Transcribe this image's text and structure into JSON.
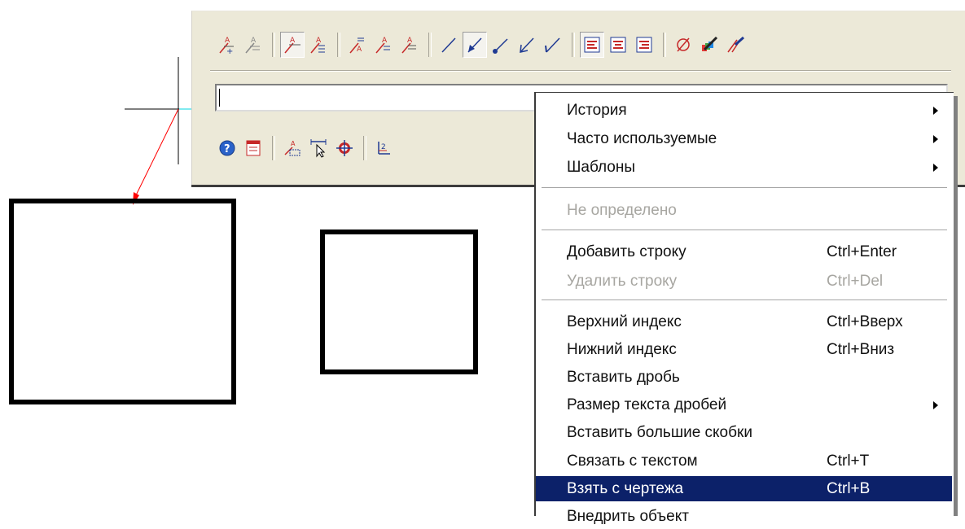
{
  "colors": {
    "panel_bg": "#ece9d8",
    "icon_red": "#c62828",
    "icon_blue": "#1f3a93",
    "selection": "#0c2169",
    "crosshair_cyan": "#00d4e0",
    "leader_red": "#ff0000"
  },
  "toolbar_top": {
    "icons": [
      "text-add-icon",
      "text-remove-icon",
      "text-leader-icon",
      "text-underline-icon",
      "text-multi-above-icon",
      "text-multi-below-icon",
      "text-three-lines-icon",
      "line-icon",
      "arrow-tail-icon",
      "dot-arrow-icon",
      "arrow-icon",
      "check-arrow-icon",
      "align-left-icon",
      "align-center-icon",
      "align-right-icon",
      "diameter-icon",
      "color-brush-icon",
      "leader-brush-icon"
    ]
  },
  "toolbar_bottom": {
    "icons": [
      "help-icon",
      "template-icon",
      "dimension-text-icon",
      "pick-dimension-icon",
      "target-icon",
      "power-index-icon"
    ]
  },
  "context_menu": {
    "items": [
      {
        "label": "История",
        "shortcut": "",
        "submenu": true,
        "disabled": false
      },
      {
        "label": "Часто используемые",
        "shortcut": "",
        "submenu": true,
        "disabled": false
      },
      {
        "label": "Шаблоны",
        "shortcut": "",
        "submenu": true,
        "disabled": false
      },
      {
        "label": "Не определено",
        "shortcut": "",
        "submenu": false,
        "disabled": true
      },
      {
        "label": "Добавить строку",
        "shortcut": "Ctrl+Enter",
        "submenu": false,
        "disabled": false
      },
      {
        "label": "Удалить строку",
        "shortcut": "Ctrl+Del",
        "submenu": false,
        "disabled": true
      },
      {
        "label": "Верхний индекс",
        "shortcut": "Ctrl+Вверх",
        "submenu": false,
        "disabled": false
      },
      {
        "label": "Нижний индекс",
        "shortcut": "Ctrl+Вниз",
        "submenu": false,
        "disabled": false
      },
      {
        "label": "Вставить дробь",
        "shortcut": "",
        "submenu": false,
        "disabled": false
      },
      {
        "label": "Размер текста дробей",
        "shortcut": "",
        "submenu": true,
        "disabled": false
      },
      {
        "label": "Вставить большие скобки",
        "shortcut": "",
        "submenu": false,
        "disabled": false
      },
      {
        "label": "Связать с текстом",
        "shortcut": "Ctrl+T",
        "submenu": false,
        "disabled": false
      },
      {
        "label": "Взять с чертежа",
        "shortcut": "Ctrl+B",
        "submenu": false,
        "disabled": false,
        "selected": true
      },
      {
        "label": "Внедрить объект",
        "shortcut": "",
        "submenu": false,
        "disabled": false
      }
    ]
  }
}
